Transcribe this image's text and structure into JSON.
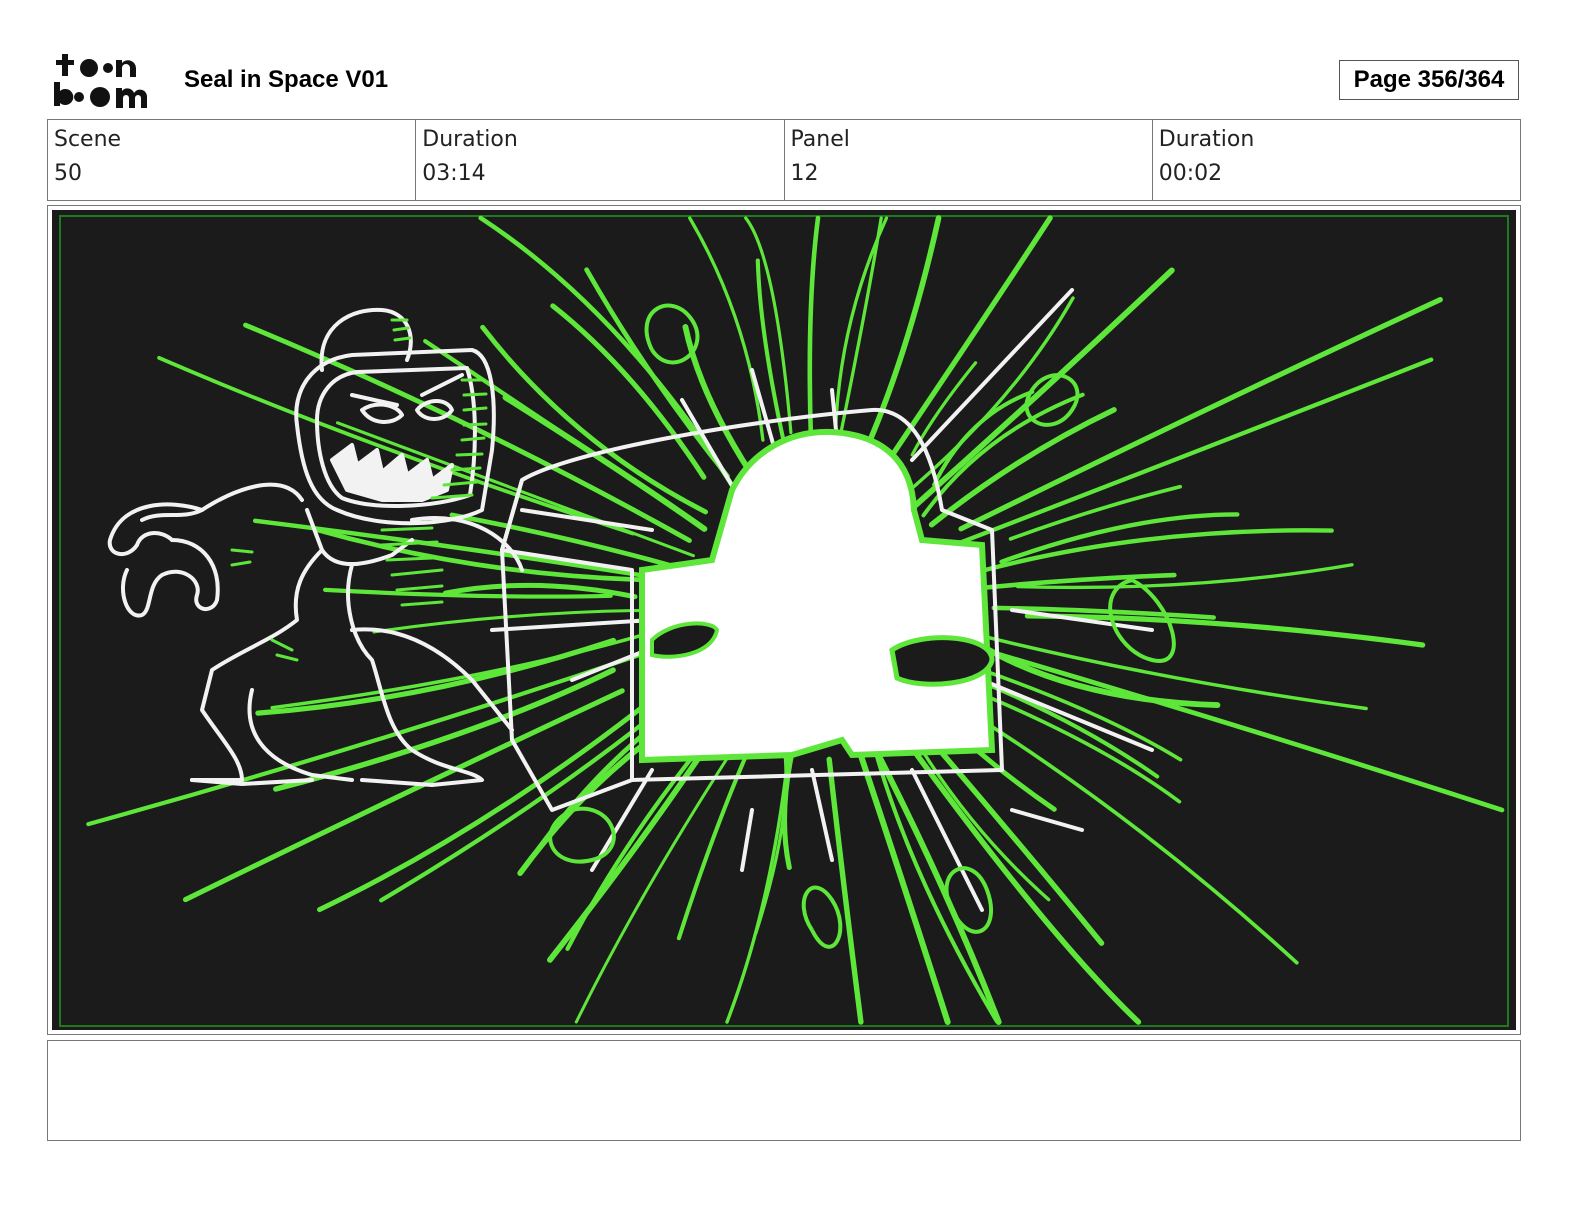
{
  "header": {
    "logo_line1": "toon",
    "logo_line2": "boom",
    "title": "Seal in Space V01",
    "page": "Page 356/364"
  },
  "info": {
    "scene_label": "Scene",
    "scene_value": "50",
    "scene_duration_label": "Duration",
    "scene_duration_value": "03:14",
    "panel_label": "Panel",
    "panel_value": "12",
    "panel_duration_label": "Duration",
    "panel_duration_value": "00:02"
  },
  "panel": {
    "background_color": "#1b1b1b",
    "line_color": "#ffffff",
    "accent_color": "#5ee63a",
    "border_color": "#1f7a1f"
  },
  "notes": {
    "text": ""
  }
}
